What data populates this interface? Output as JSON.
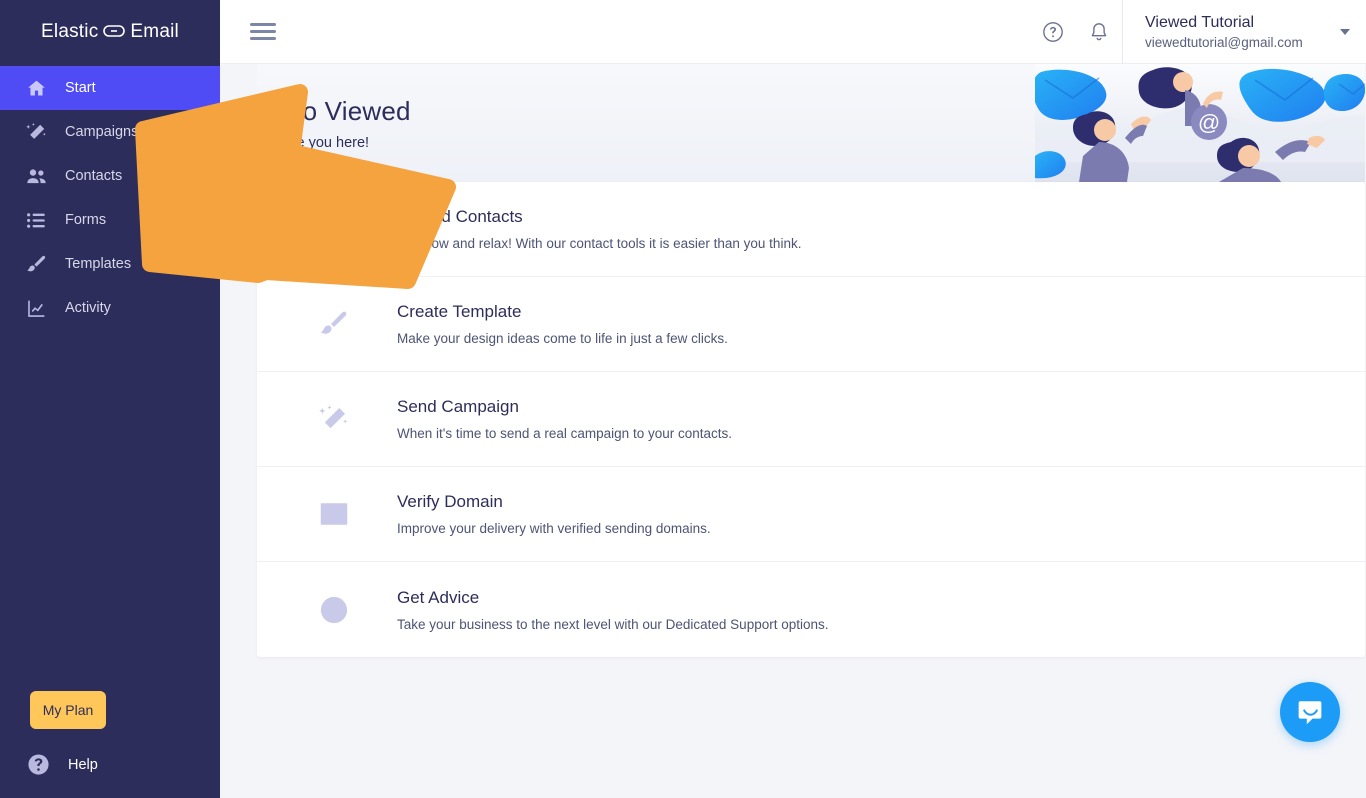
{
  "colors": {
    "sidebar_bg": "#2d2d5b",
    "sidebar_active": "#4f4bf5",
    "accent_orange": "#f5a33f",
    "plan_button": "#ffc75a",
    "chat_blue": "#1c9cf6",
    "heading_navy": "#2d2d5b"
  },
  "sidebar": {
    "brand": {
      "left": "Elastic",
      "loop_icon": "loop-icon",
      "right": "Email"
    },
    "items": [
      {
        "label": "Start",
        "icon": "home-icon",
        "active": true
      },
      {
        "label": "Campaigns",
        "icon": "magic-wand-icon",
        "active": false
      },
      {
        "label": "Contacts",
        "icon": "people-icon",
        "active": false
      },
      {
        "label": "Forms",
        "icon": "list-icon",
        "active": false
      },
      {
        "label": "Templates",
        "icon": "paintbrush-icon",
        "active": false
      },
      {
        "label": "Activity",
        "icon": "chart-line-icon",
        "active": false
      }
    ],
    "plan_button": "My Plan",
    "help": {
      "label": "Help",
      "icon": "question-circle-icon"
    }
  },
  "topbar": {
    "menu_icon": "hamburger-icon",
    "help_icon": "question-circle-icon",
    "notifications_icon": "bell-icon",
    "user": {
      "name": "Viewed Tutorial",
      "email": "viewedtutorial@gmail.com",
      "caret_icon": "chevron-down-icon"
    }
  },
  "hero": {
    "heading": "Hello Viewed",
    "subheading": "to have you here!",
    "illustration": "people-waving-email-illustration"
  },
  "tasks": [
    {
      "title": "Upload Contacts",
      "desc": "ad, grow and relax! With our contact tools it is easier than you think.",
      "icon": "upload-contacts-icon"
    },
    {
      "title": "Create Template",
      "desc": "Make your design ideas come to life in just a few clicks.",
      "icon": "paintbrush-icon"
    },
    {
      "title": "Send Campaign",
      "desc": "When it's time to send a real campaign to your contacts.",
      "icon": "magic-wand-icon"
    },
    {
      "title": "Verify Domain",
      "desc": "Improve your delivery with verified sending domains.",
      "icon": "browser-window-icon"
    },
    {
      "title": "Get Advice",
      "desc": "Take your business to the next level with our Dedicated Support options.",
      "icon": "question-circle-icon"
    }
  ],
  "annotation": {
    "arrow": "orange-pointer-arrow",
    "points_to": "Campaigns"
  },
  "chat": {
    "icon": "intercom-chat-icon"
  }
}
